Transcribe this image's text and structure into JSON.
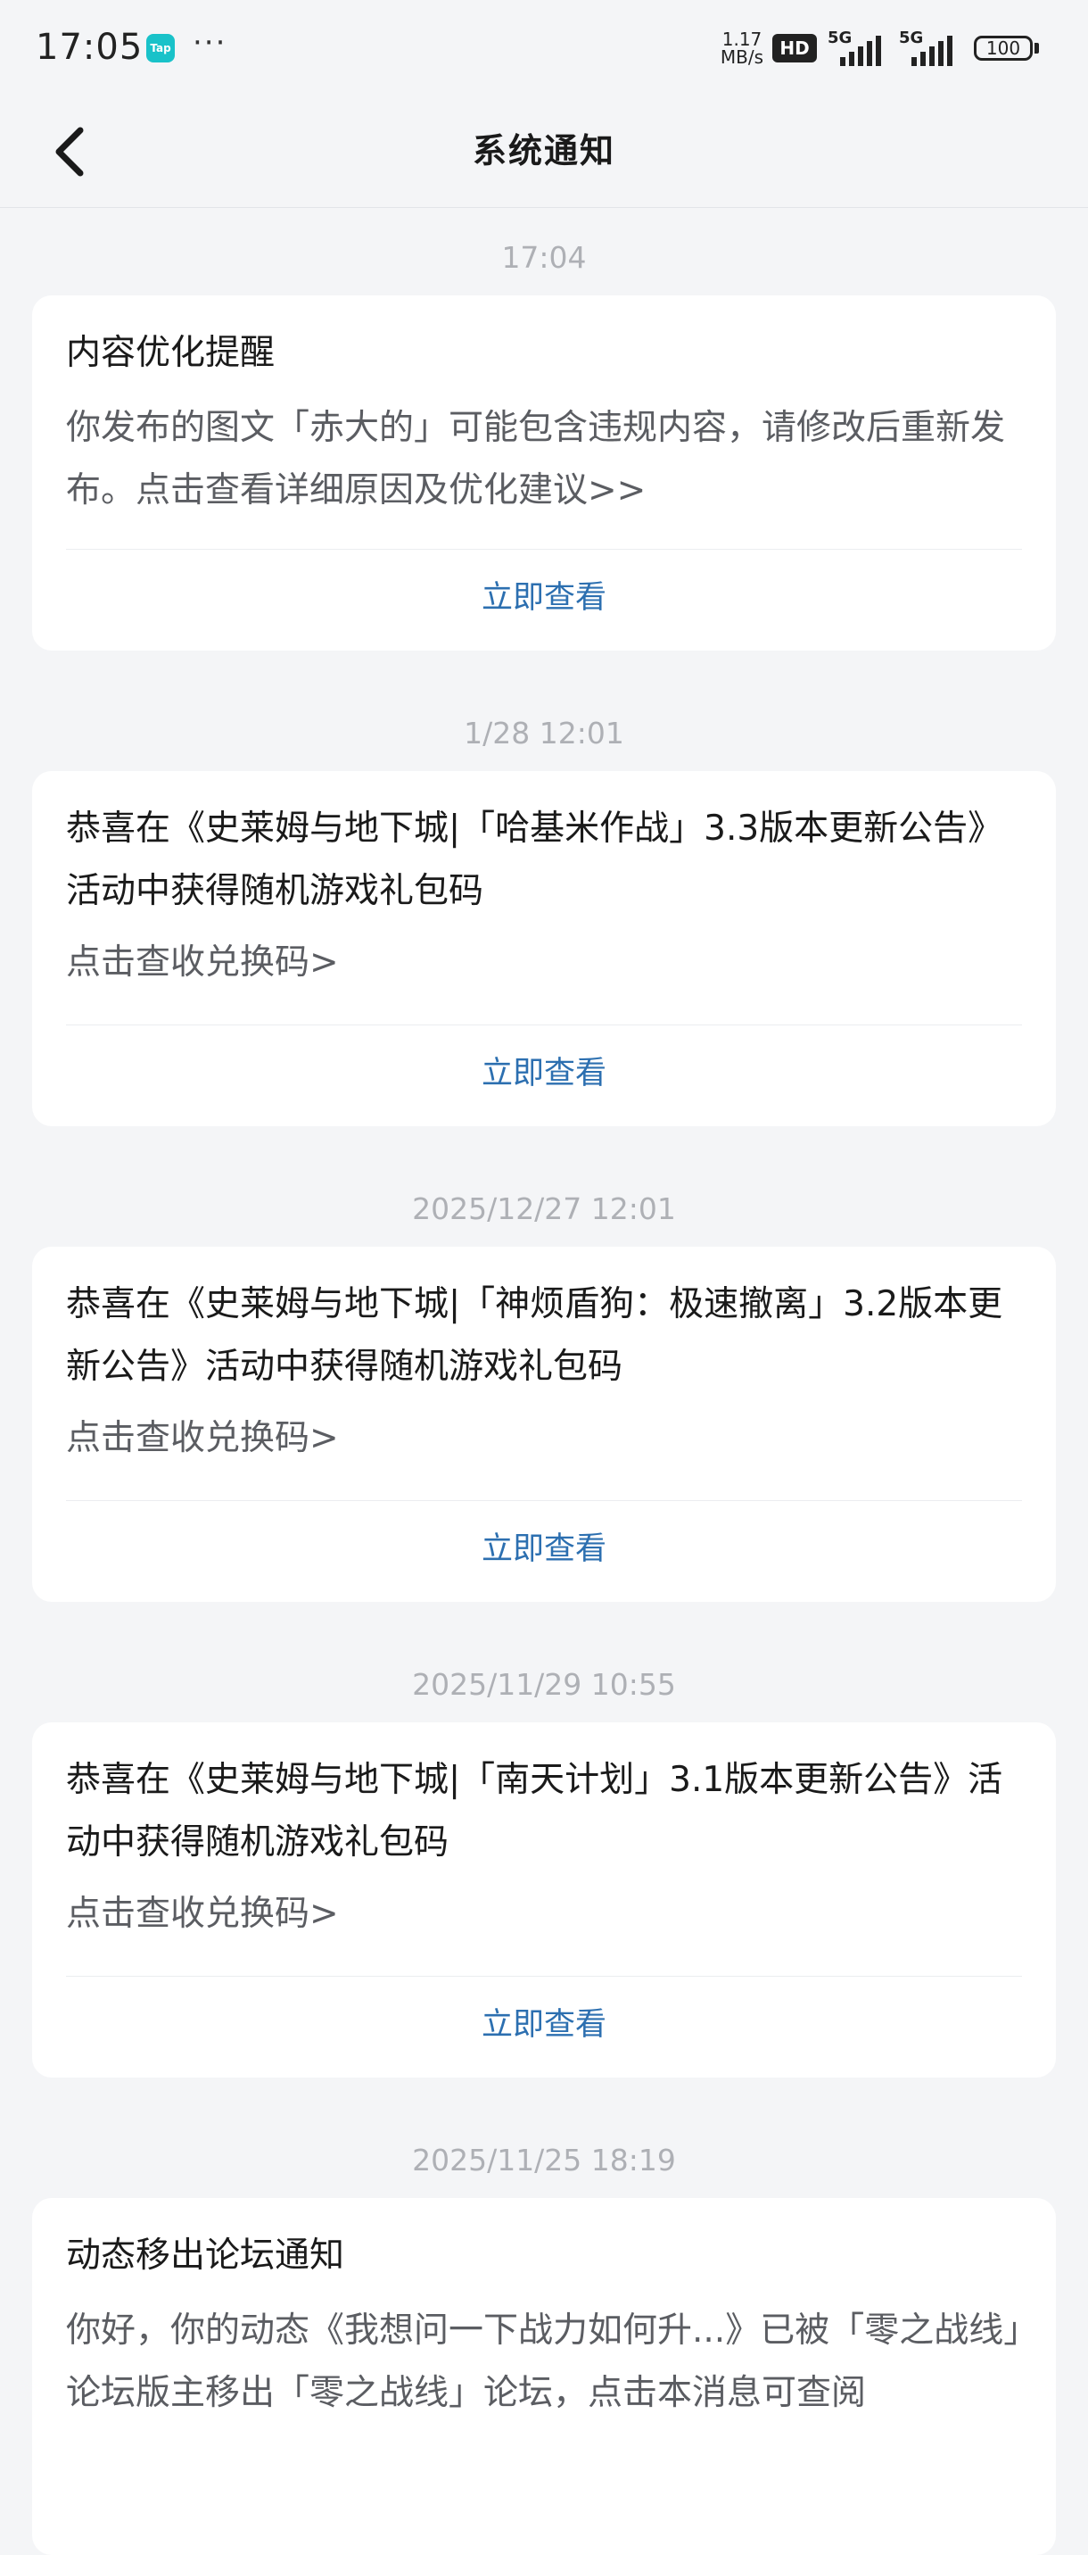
{
  "status_bar": {
    "time": "17:05",
    "app_badge": "Tap",
    "more": "···",
    "net_speed_value": "1.17",
    "net_speed_unit": "MB/s",
    "hd": "HD",
    "signal1": "5G",
    "signal2": "5G",
    "battery": "100"
  },
  "header": {
    "title": "系统通知"
  },
  "messages": [
    {
      "time": "17:04",
      "title": "内容优化提醒",
      "desc": "你发布的图文「赤大的」可能包含违规内容，请修改后重新发布。点击查看详细原因及优化建议>>",
      "action": "立即查看"
    },
    {
      "time": "1/28  12:01",
      "title": "恭喜在《史莱姆与地下城|「哈基米作战」3.3版本更新公告》活动中获得随机游戏礼包码",
      "desc": "点击查收兑换码>",
      "action": "立即查看"
    },
    {
      "time": "2025/12/27  12:01",
      "title": "恭喜在《史莱姆与地下城|「神烦盾狗：极速撤离」3.2版本更新公告》活动中获得随机游戏礼包码",
      "desc": "点击查收兑换码>",
      "action": "立即查看"
    },
    {
      "time": "2025/11/29  10:55",
      "title": "恭喜在《史莱姆与地下城|「南天计划」3.1版本更新公告》活动中获得随机游戏礼包码",
      "desc": "点击查收兑换码>",
      "action": "立即查看"
    },
    {
      "time": "2025/11/25  18:19",
      "title": "动态移出论坛通知",
      "desc": "你好，你的动态《我想问一下战力如何升...》已被「零之战线」论坛版主移出「零之战线」论坛，点击本消息可查阅",
      "action": ""
    }
  ],
  "colors": {
    "background": "#f4f5f7",
    "card": "#ffffff",
    "action_link": "#2c6fb0",
    "timestamp": "#aeb0b5",
    "secondary_text": "#5b5d62"
  }
}
